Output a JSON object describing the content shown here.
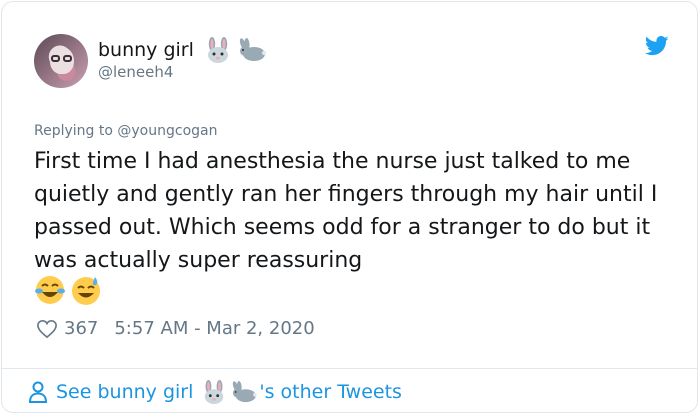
{
  "author": {
    "display_name": "bunny girl",
    "handle": "@leneeh4"
  },
  "reply": {
    "prefix": "Replying to ",
    "mention": "@youngcogan"
  },
  "tweet": {
    "text": "First time I had anesthesia the nurse just talked to me quietly and gently ran her fingers through my hair until I passed out. Which seems odd for a stranger to do but it was actually super reassuring"
  },
  "stats": {
    "likes": "367",
    "timestamp": "5:57 AM - Mar 2, 2020"
  },
  "footer": {
    "prefix": "See bunny girl",
    "suffix": "'s other Tweets"
  },
  "icons": {
    "emoji_after_name": [
      "rabbit-face-icon",
      "rabbit-icon"
    ],
    "emoji_after_text": [
      "tears-of-joy-icon",
      "grinning-sweat-icon"
    ],
    "brand": "twitter-bird-icon"
  },
  "colors": {
    "link_blue": "#1b95e0",
    "muted_gray": "#657786",
    "text_dark": "#14171a",
    "twitter_blue": "#1da1f2"
  }
}
